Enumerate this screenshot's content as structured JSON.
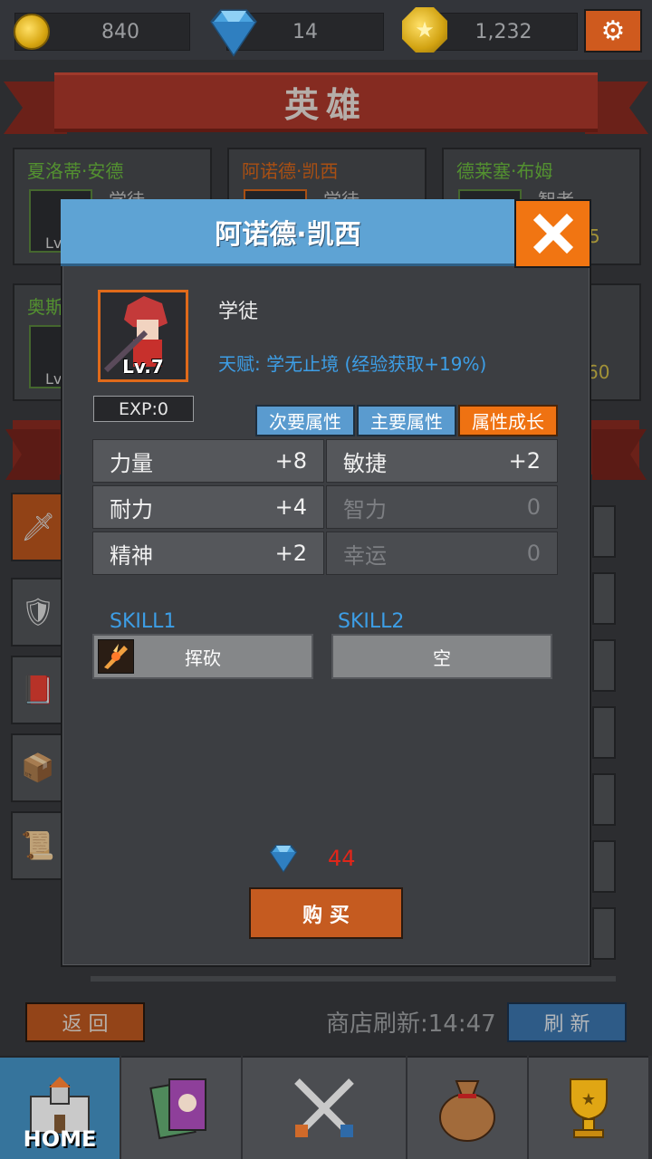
{
  "currency": {
    "gold": "840",
    "gems": "14",
    "stars": "1,232"
  },
  "banner_title": "英雄",
  "background_heroes": [
    {
      "name": "夏洛蒂·安德",
      "class": "学徒",
      "name_color": "#6fc241"
    },
    {
      "name": "阿诺德·凯西",
      "class": "学徒",
      "name_color": "#e06a1a"
    },
    {
      "name": "德莱塞·布姆",
      "class": "智者",
      "name_color": "#6fc241"
    },
    {
      "name": "奥斯",
      "class": "",
      "name_color": "#6fc241"
    }
  ],
  "background_partial": {
    "lv_prefix": "Lv",
    "right_num_1": "5",
    "right_num_2": "60"
  },
  "modal": {
    "title": "阿诺德·凯西",
    "level": "Lv.7",
    "class": "学徒",
    "talent": "天赋: 学无止境 (经验获取+19%)",
    "exp": "EXP:0",
    "tabs": [
      "次要属性",
      "主要属性",
      "属性成长"
    ],
    "active_tab": 2,
    "stats": [
      {
        "name": "力量",
        "value": "+8",
        "active": true
      },
      {
        "name": "敏捷",
        "value": "+2",
        "active": true
      },
      {
        "name": "耐力",
        "value": "+4",
        "active": true
      },
      {
        "name": "智力",
        "value": "0",
        "active": false
      },
      {
        "name": "精神",
        "value": "+2",
        "active": true
      },
      {
        "name": "幸运",
        "value": "0",
        "active": false
      }
    ],
    "skill1_label": "SKILL1",
    "skill1_name": "挥砍",
    "skill2_label": "SKILL2",
    "skill2_name": "空",
    "price": "44",
    "buy_label": "购 买"
  },
  "footer": {
    "back_label": "返 回",
    "refresh_timer": "商店刷新:14:47",
    "refresh_label": "刷 新"
  },
  "nav": {
    "home_label": "HOME",
    "active": "home"
  },
  "colors": {
    "accent_blue": "#5ea3d4",
    "accent_orange": "#f17512",
    "talent_blue": "#3d9ee6",
    "price_red": "#e0261a"
  }
}
